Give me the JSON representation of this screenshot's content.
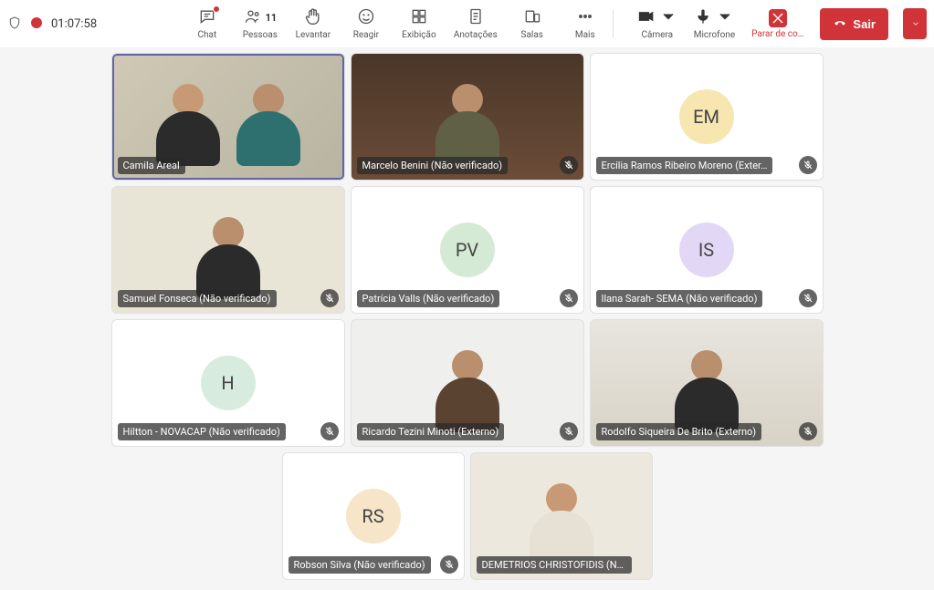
{
  "timer": "01:07:58",
  "toolbar": {
    "chat": "Chat",
    "people": "Pessoas",
    "people_count": "11",
    "raise": "Levantar",
    "react": "Reagir",
    "view": "Exibição",
    "notes": "Anotações",
    "rooms": "Salas",
    "more": "Mais",
    "camera": "Câmera",
    "mic": "Microfone",
    "stop_share": "Parar de co…",
    "leave": "Sair"
  },
  "tiles": {
    "r1c1": "Camila Areal",
    "r1c2": "Marcelo Benini (Não verificado)",
    "r1c3": "Ercilia Ramos Ribeiro Moreno (Exter…",
    "r1c3_initials": "EM",
    "r2c1": "Samuel Fonseca (Não verificado)",
    "r2c2": "Patrícia Valls (Não verificado)",
    "r2c2_initials": "PV",
    "r2c3": "Ilana Sarah- SEMA (Não verificado)",
    "r2c3_initials": "IS",
    "r3c1": "Hiltton - NOVACAP (Não verificado)",
    "r3c1_initials": "H",
    "r3c2": "Ricardo Tezini Minoti (Externo)",
    "r3c3": "Rodolfo Siqueira De Brito (Externo)",
    "r4c1": "Robson Silva (Não verificado)",
    "r4c1_initials": "RS",
    "r4c2": "DEMETRIOS CHRISTOFIDIS (Não verifica…"
  }
}
